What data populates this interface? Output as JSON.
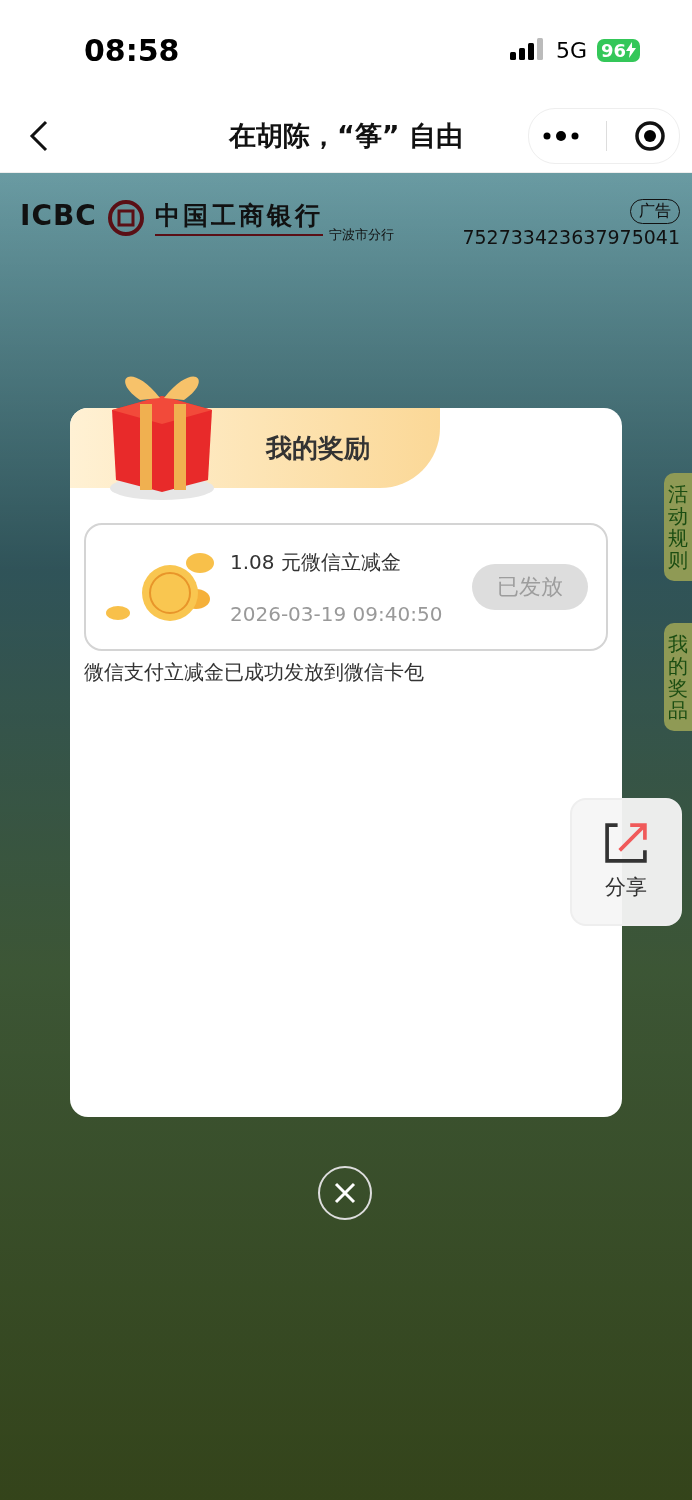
{
  "status_bar": {
    "time": "08:58",
    "network": "5G",
    "battery": "96"
  },
  "nav_bar": {
    "title": "在胡陈，“筝” 自由"
  },
  "banner": {
    "logo_text": "ICBC",
    "bank_name": "中国工商银行",
    "branch": "宁波市分行",
    "ad_badge": "广告",
    "ad_id": "752733423637975041"
  },
  "side_tabs": [
    "活动规则",
    "我的奖品"
  ],
  "share_button": {
    "label": "分享"
  },
  "modal": {
    "title": "我的奖励",
    "rewards": [
      {
        "name": "1.08 元微信立减金",
        "time": "2026-03-19 09:40:50",
        "button": "已发放",
        "disabled": true
      }
    ],
    "note": "微信支付立减金已成功发放到微信卡包"
  }
}
